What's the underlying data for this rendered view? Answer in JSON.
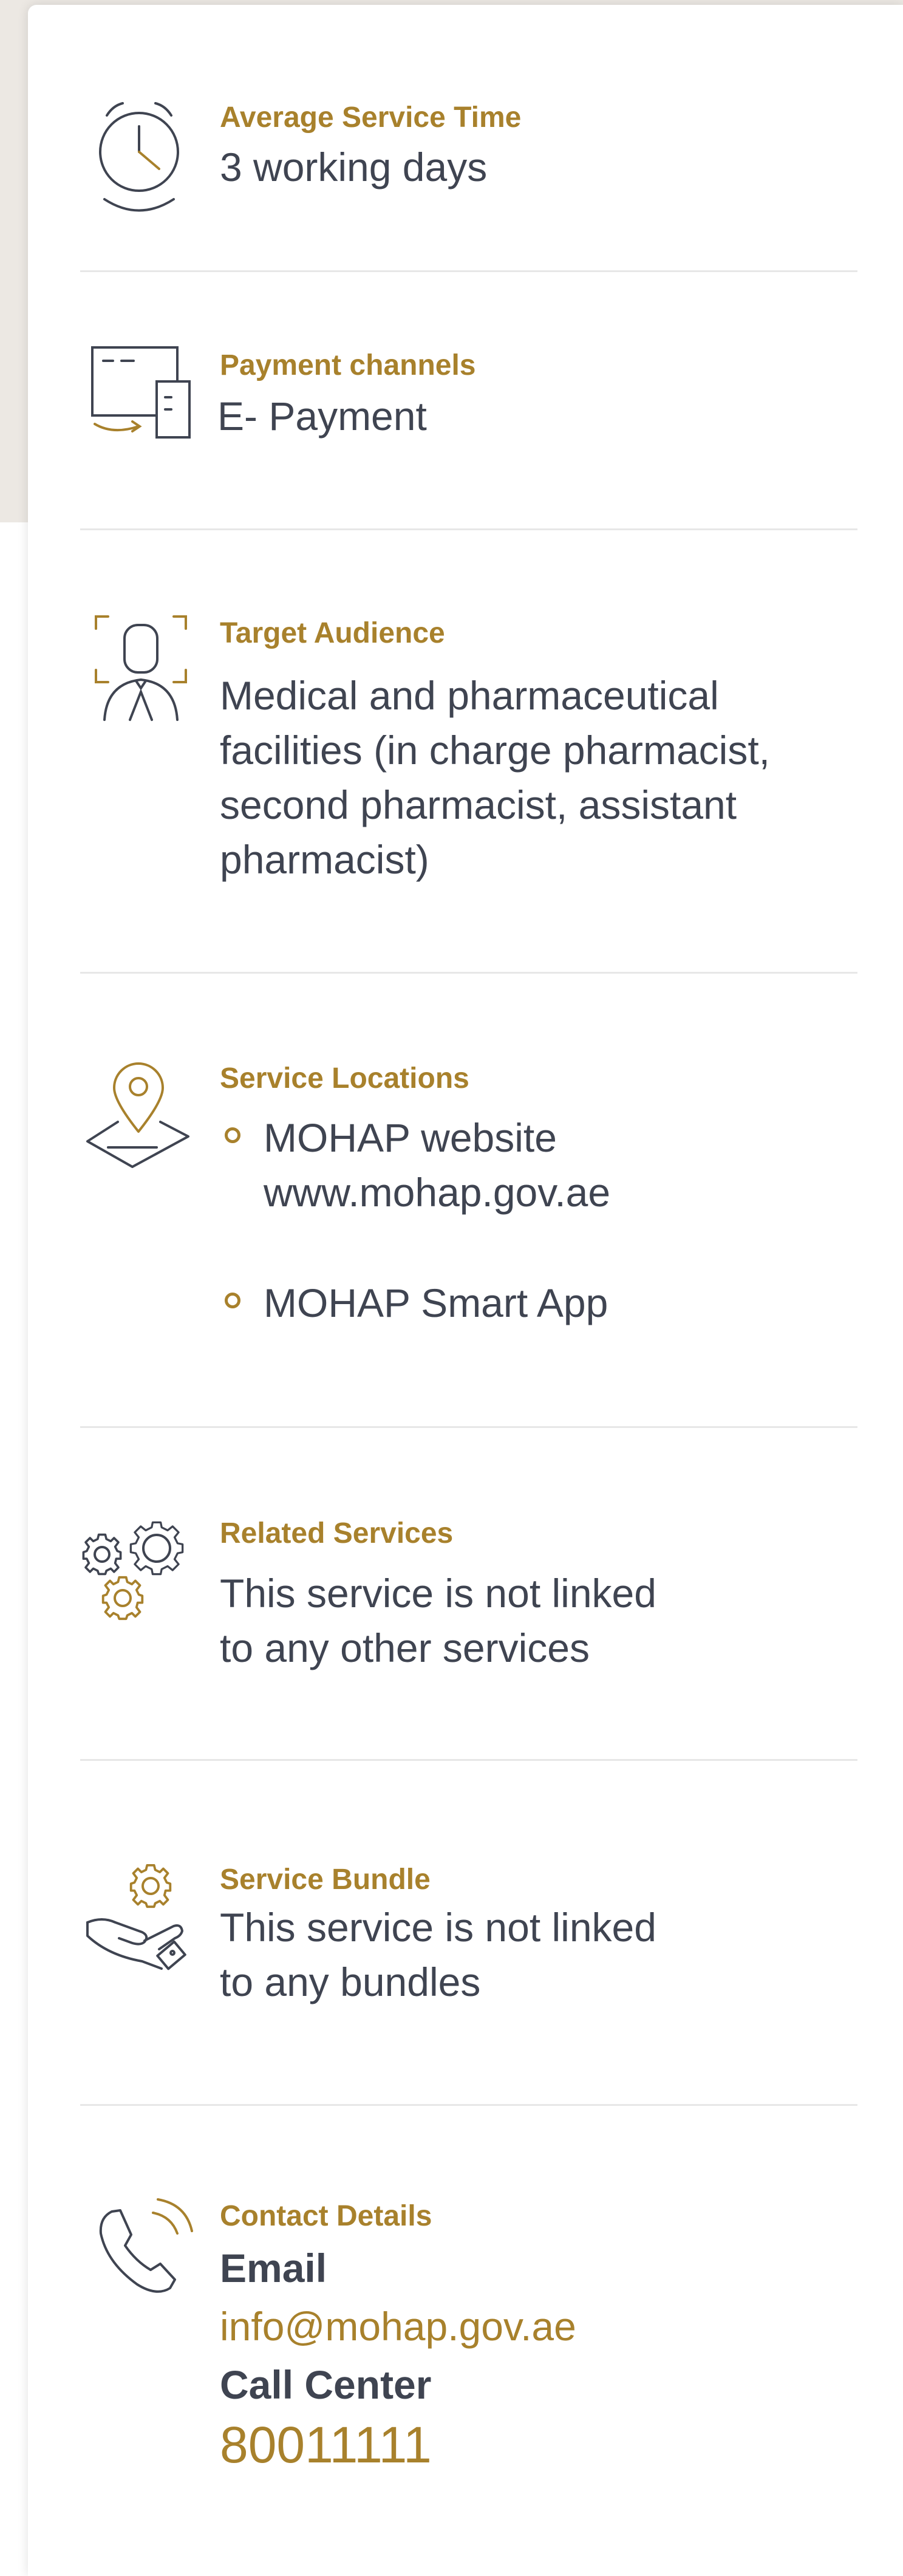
{
  "sections": {
    "service_time": {
      "label": "Average Service Time",
      "value": "3 working days",
      "icon": "clock-icon"
    },
    "payment": {
      "label": "Payment channels",
      "value": "E- Payment",
      "icon": "payment-terminal-icon"
    },
    "audience": {
      "label": "Target Audience",
      "lines": [
        "Medical and pharmaceutical",
        "facilities (in charge pharmacist,",
        "second pharmacist, assistant",
        "pharmacist)"
      ],
      "icon": "person-scan-icon"
    },
    "locations": {
      "label": "Service Locations",
      "items": [
        {
          "lines": [
            "MOHAP website",
            "www.mohap.gov.ae"
          ]
        },
        {
          "lines": [
            "MOHAP Smart App"
          ]
        }
      ],
      "icon": "map-pin-icon"
    },
    "related": {
      "label": "Related Services",
      "lines": [
        "This service is not linked",
        "to any other services"
      ],
      "icon": "gears-icon"
    },
    "bundle": {
      "label": "Service Bundle",
      "lines": [
        "This service is not linked",
        "to any bundles"
      ],
      "icon": "hand-gear-icon"
    },
    "contact": {
      "label": "Contact Details",
      "email_heading": "Email",
      "email": "info@mohap.gov.ae",
      "call_heading": "Call Center",
      "phone": "80011111",
      "icon": "phone-icon"
    }
  },
  "colors": {
    "accent": "#a8812c",
    "text": "#3f4451",
    "icon_stroke": "#3f4451",
    "divider": "#e7e7e7",
    "background_band": "#ece8e3"
  }
}
